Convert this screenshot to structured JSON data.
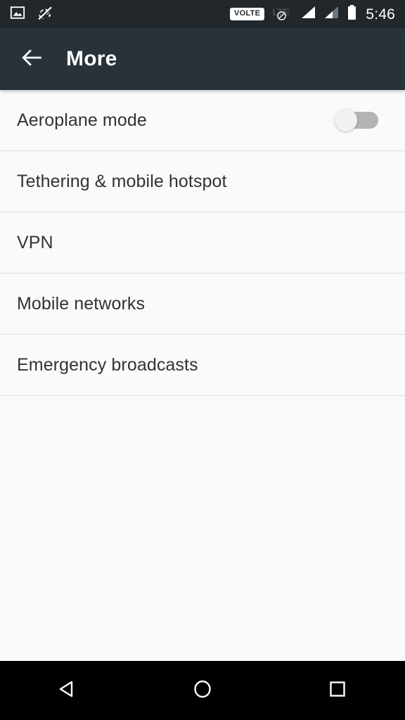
{
  "status_bar": {
    "left_icons": [
      {
        "name": "photo-icon",
        "label": "screenshot"
      },
      {
        "name": "vibrate-off-icon",
        "label": "ringer muted"
      }
    ],
    "volte_label": "VOLTE",
    "network_type_label": "LTE",
    "network_data_disabled": true,
    "signal_bars": [
      {
        "name": "signal-sim1-icon",
        "strength": "full"
      },
      {
        "name": "signal-sim2-icon",
        "strength": "partial"
      }
    ],
    "battery": {
      "name": "battery-full-icon",
      "level": "full"
    },
    "time": "5:46",
    "background_color": "#21272b"
  },
  "app_bar": {
    "back_icon": "arrow-back-icon",
    "title": "More",
    "background_color": "#283238",
    "text_color": "#ffffff"
  },
  "settings": {
    "items": [
      {
        "label": "Aeroplane mode",
        "type": "toggle",
        "toggle_on": false
      },
      {
        "label": "Tethering & mobile hotspot",
        "type": "link"
      },
      {
        "label": "VPN",
        "type": "link"
      },
      {
        "label": "Mobile networks",
        "type": "link"
      },
      {
        "label": "Emergency broadcasts",
        "type": "link"
      }
    ],
    "background_color": "#fafafa",
    "divider_color": "#e0e0e0",
    "label_color": "#333333"
  },
  "nav_bar": {
    "buttons": [
      {
        "name": "nav-back-button",
        "label": "Back"
      },
      {
        "name": "nav-home-button",
        "label": "Home"
      },
      {
        "name": "nav-recents-button",
        "label": "Recents"
      }
    ],
    "background_color": "#000000"
  }
}
